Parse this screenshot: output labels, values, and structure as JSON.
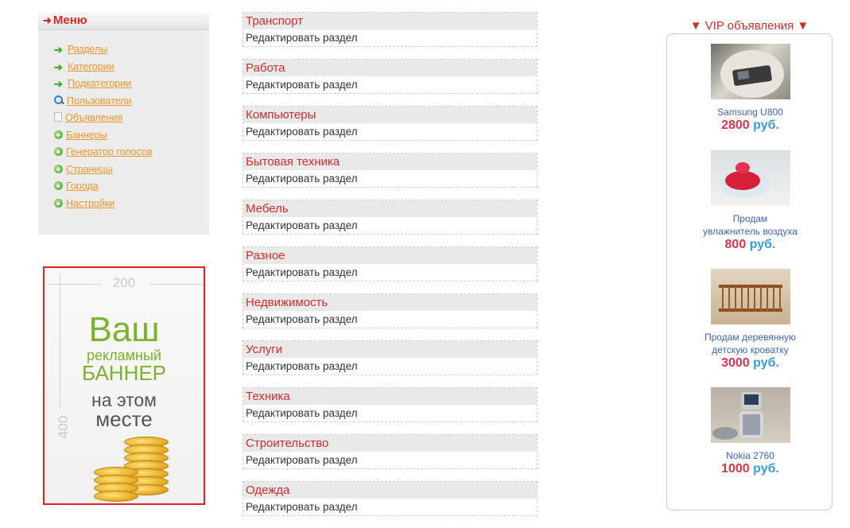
{
  "menu": {
    "title": "Меню",
    "items": [
      {
        "label": "Разделы",
        "icon": "green-arrow-icon"
      },
      {
        "label": "Категории",
        "icon": "green-arrow-icon"
      },
      {
        "label": "Подкатегории",
        "icon": "green-arrow-icon"
      },
      {
        "label": "Пользователи",
        "icon": "magnifier-icon"
      },
      {
        "label": "Объявления",
        "icon": "document-icon"
      },
      {
        "label": "Баннеры",
        "icon": "green-plus-icon"
      },
      {
        "label": "Генератор голосов",
        "icon": "green-plus-icon"
      },
      {
        "label": "Страницы",
        "icon": "green-plus-icon"
      },
      {
        "label": "Города",
        "icon": "green-plus-icon"
      },
      {
        "label": "Настройки",
        "icon": "green-plus-icon"
      }
    ]
  },
  "banner": {
    "width_label": "200",
    "height_label": "400",
    "line1": "Ваш",
    "line2": "рекламный",
    "line3": "БАННЕР",
    "line4": "на этом",
    "line5": "месте"
  },
  "sections": [
    {
      "title": "Транспорт",
      "edit": "Редактировать раздел"
    },
    {
      "title": "Работа",
      "edit": "Редактировать раздел"
    },
    {
      "title": "Компьютеры",
      "edit": "Редактировать раздел"
    },
    {
      "title": "Бытовая техника",
      "edit": "Редактировать раздел"
    },
    {
      "title": "Мебель",
      "edit": "Редактировать раздел"
    },
    {
      "title": "Разное",
      "edit": "Редактировать раздел"
    },
    {
      "title": "Недвижимость",
      "edit": "Редактировать раздел"
    },
    {
      "title": "Услуги",
      "edit": "Редактировать раздел"
    },
    {
      "title": "Техника",
      "edit": "Редактировать раздел"
    },
    {
      "title": "Строительство",
      "edit": "Редактировать раздел"
    },
    {
      "title": "Одежда",
      "edit": "Редактировать раздел"
    }
  ],
  "vip": {
    "title": "VIP объявления",
    "items": [
      {
        "name_line1": "Samsung U800",
        "name_line2": "",
        "price": "2800",
        "currency": "руб."
      },
      {
        "name_line1": "Продам",
        "name_line2": "увлажнитель воздуха",
        "price": "800",
        "currency": "руб."
      },
      {
        "name_line1": "Продам деревянную",
        "name_line2": "детскую кроватку",
        "price": "3000",
        "currency": "руб."
      },
      {
        "name_line1": "Nokia 2760",
        "name_line2": "",
        "price": "1000",
        "currency": "руб."
      }
    ]
  },
  "colors": {
    "accent_red": "#d62b2b",
    "menu_link": "#f2962a",
    "vip_name": "#3d62b8",
    "price_red": "#e0304a",
    "currency_blue": "#3a9be0"
  }
}
